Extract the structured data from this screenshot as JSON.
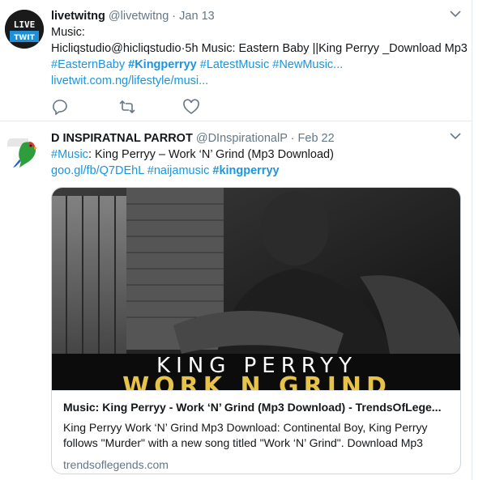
{
  "tweets": [
    {
      "name": "livetwitng",
      "handle": "@livetwitng",
      "separator": "·",
      "time": "Jan 13",
      "avatar_text_top": "LIVE",
      "avatar_text_bottom": "TWIT",
      "line1": "Music:",
      "line2": "Hicliqstudio@hicliqstudio·5h Music: Eastern Baby ||King Perryy _Download Mp3",
      "hashtags": [
        "#EasternBaby",
        "#Kingperryy",
        "#LatestMusic",
        "#NewMusic..."
      ],
      "link": "livetwit.com.ng/lifestyle/musi..."
    },
    {
      "name": "D INSPIRATNAL PARROT",
      "handle": "@DInspirationalP",
      "separator": "·",
      "time": "Feb 22",
      "hashtag_music": "#Music",
      "text_rest": ": King Perryy – Work ‘N’ Grind (Mp3 Download)",
      "link": "goo.gl/fb/Q7DEhL",
      "hashtag_naija": "#naijamusic",
      "hashtag_kp": "#kingperryy",
      "card": {
        "image_caption_top": "KING PERRYY",
        "image_caption_bottom": "WORK N GRIND",
        "title": "Music: King Perryy - Work ‘N’ Grind (Mp3 Download) - TrendsOfLege...",
        "description": "King Perryy Work ‘N’ Grind Mp3 Download: Continental Boy, King Perryy follows \"Murder\" with a new song titled \"Work ‘N’ Grind\". Download Mp3",
        "domain": "trendsoflegends.com"
      }
    }
  ],
  "icons": [
    "reply-icon",
    "retweet-icon",
    "like-icon",
    "chevron-down-icon"
  ],
  "colors": {
    "link": "#1b95e0",
    "muted": "#657786",
    "border": "#e6ecf0"
  }
}
